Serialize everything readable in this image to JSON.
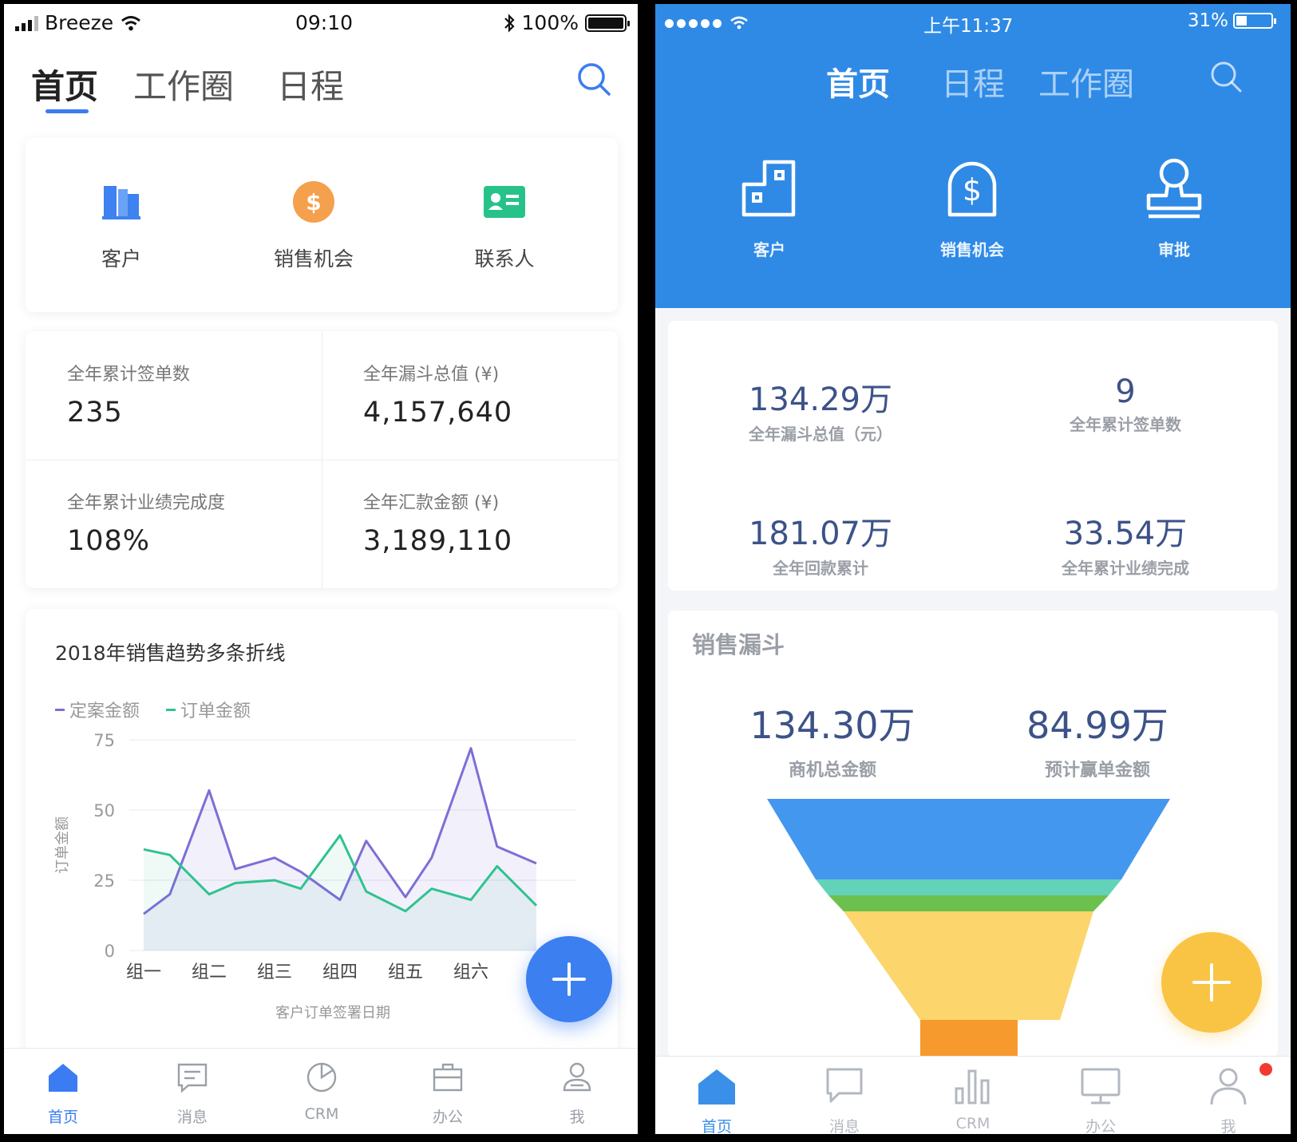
{
  "left": {
    "status": {
      "carrier": "Breeze",
      "time": "09:10",
      "battery": "100%"
    },
    "tabs": [
      {
        "label": "首页"
      },
      {
        "label": "工作圈"
      },
      {
        "label": "日程"
      }
    ],
    "shortcuts": [
      {
        "label": "客户",
        "icon": "building-icon",
        "color": "#3d82f0"
      },
      {
        "label": "销售机会",
        "icon": "dollar-coin-icon",
        "color": "#f5a04c"
      },
      {
        "label": "联系人",
        "icon": "contact-card-icon",
        "color": "#27c28a"
      }
    ],
    "stats": [
      {
        "title": "全年累计签单数",
        "value": "235"
      },
      {
        "title": "全年漏斗总值 (¥)",
        "value": "4,157,640"
      },
      {
        "title": "全年累计业绩完成度",
        "value": "108%"
      },
      {
        "title": "全年汇款金额 (¥)",
        "value": "3,189,110"
      }
    ],
    "chart_data": {
      "type": "line",
      "title": "2018年销售趋势多条折线",
      "categories": [
        "组一",
        "组二",
        "组三",
        "组四",
        "组五",
        "组六"
      ],
      "x": [
        0,
        0.4,
        1,
        1.4,
        2,
        2.4,
        3,
        3.4,
        4,
        4.4,
        5,
        5.4,
        6
      ],
      "series": [
        {
          "name": "定案金额",
          "color": "#7b6fd6",
          "values": [
            13,
            20,
            57,
            29,
            33,
            28,
            18,
            39,
            19,
            33,
            72,
            37,
            31
          ]
        },
        {
          "name": "订单金额",
          "color": "#2fc38f",
          "values": [
            36,
            34,
            20,
            24,
            25,
            22,
            41,
            21,
            14,
            22,
            18,
            30,
            16
          ]
        }
      ],
      "ylabel": "订单金额",
      "xlabel": "客户订单签署日期",
      "yticks": [
        0,
        25,
        50,
        75
      ],
      "ylim": [
        0,
        75
      ],
      "grid": true,
      "legend": "top-left"
    },
    "tabbar": [
      {
        "label": "首页",
        "icon": "home-icon",
        "active": true
      },
      {
        "label": "消息",
        "icon": "message-icon",
        "active": false
      },
      {
        "label": "CRM",
        "icon": "pie-chart-icon",
        "active": false
      },
      {
        "label": "办公",
        "icon": "briefcase-icon",
        "active": false
      },
      {
        "label": "我",
        "icon": "user-icon",
        "active": false
      }
    ]
  },
  "right": {
    "status": {
      "time": "上午11:37",
      "battery": "31%"
    },
    "tabs": [
      {
        "label": "首页"
      },
      {
        "label": "日程"
      },
      {
        "label": "工作圈"
      }
    ],
    "shortcuts": [
      {
        "label": "客户",
        "icon": "building-outline-icon"
      },
      {
        "label": "销售机会",
        "icon": "dollar-outline-icon"
      },
      {
        "label": "审批",
        "icon": "stamp-icon"
      }
    ],
    "stats": [
      {
        "value": "134.29万",
        "title": "全年漏斗总值（元）"
      },
      {
        "value": "9",
        "title": "全年累计签单数"
      },
      {
        "value": "181.07万",
        "title": "全年回款累计"
      },
      {
        "value": "33.54万",
        "title": "全年累计业绩完成"
      }
    ],
    "funnel": {
      "title": "销售漏斗",
      "stats": [
        {
          "value": "134.30万",
          "title": "商机总金额"
        },
        {
          "value": "84.99万",
          "title": "预计赢单金额"
        }
      ],
      "stage_colors": [
        "#4497ef",
        "#62d3b8",
        "#6cc04d",
        "#fcd66c",
        "#f79a2e"
      ]
    },
    "tabbar": [
      {
        "label": "首页",
        "icon": "home-icon",
        "active": true
      },
      {
        "label": "消息",
        "icon": "chat-bubble-icon",
        "active": false
      },
      {
        "label": "CRM",
        "icon": "bar-chart-icon",
        "active": false
      },
      {
        "label": "办公",
        "icon": "monitor-icon",
        "active": false
      },
      {
        "label": "我",
        "icon": "user-icon",
        "active": false
      }
    ]
  }
}
